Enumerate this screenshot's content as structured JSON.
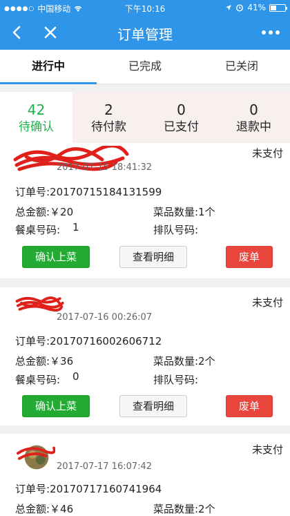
{
  "status_bar": {
    "signal_dots": "●●●●○",
    "carrier": "中国移动",
    "time": "下午10:16",
    "battery": "41%",
    "battery_level": 0.41
  },
  "nav": {
    "title": "订单管理"
  },
  "tabs": [
    {
      "label": "进行中",
      "active": true
    },
    {
      "label": "已完成",
      "active": false
    },
    {
      "label": "已关闭",
      "active": false
    }
  ],
  "stats": [
    {
      "count": "42",
      "label": "待确认",
      "active": true
    },
    {
      "count": "2",
      "label": "待付款",
      "active": false
    },
    {
      "count": "0",
      "label": "已支付",
      "active": false
    },
    {
      "count": "0",
      "label": "退款中",
      "active": false
    }
  ],
  "orders": [
    {
      "status": "未支付",
      "time": "2017-07-15 18:41:32",
      "order_no": "订单号:20170715184131599",
      "total": "总金额:￥20",
      "dish_count": "菜品数量:1个",
      "table_label": "餐桌号码:",
      "table_no": "1",
      "queue": "排队号码:",
      "btn_confirm": "确认上菜",
      "btn_detail": "查看明细",
      "btn_void": "废单"
    },
    {
      "status": "未支付",
      "time": "2017-07-16 00:26:07",
      "order_no": "订单号:20170716002606712",
      "total": "总金额:￥36",
      "dish_count": "菜品数量:2个",
      "table_label": "餐桌号码:",
      "table_no": "0",
      "queue": "排队号码:",
      "btn_confirm": "确认上菜",
      "btn_detail": "查看明细",
      "btn_void": "废单"
    },
    {
      "status": "未支付",
      "time": "2017-07-17 16:07:42",
      "order_no": "订单号:20170717160741964",
      "total": "总金额:￥46",
      "dish_count": "菜品数量:2个"
    }
  ]
}
